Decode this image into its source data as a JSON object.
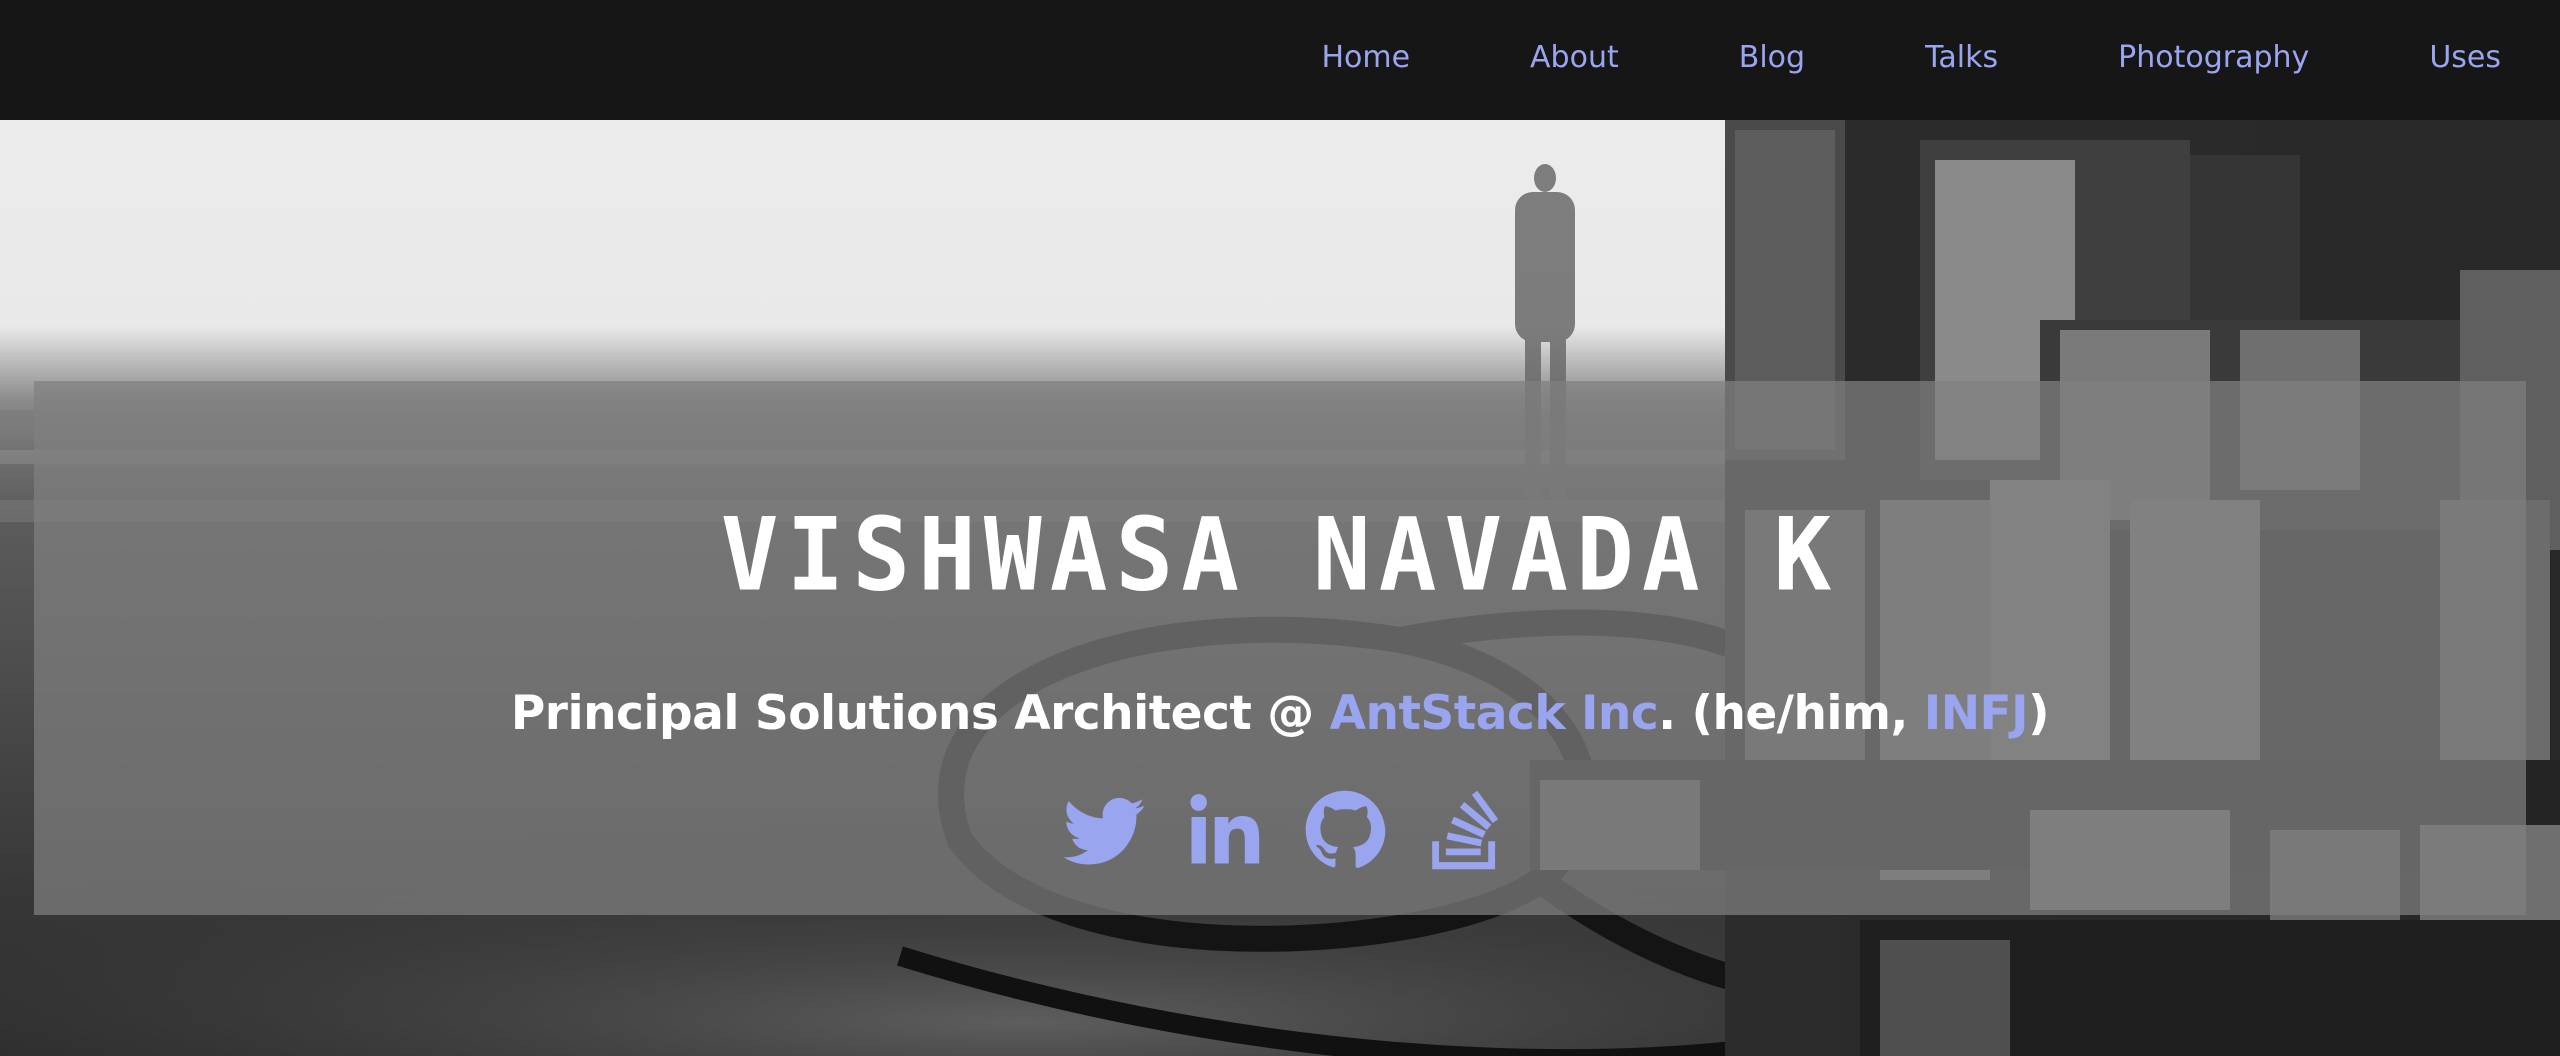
{
  "nav": {
    "items": [
      {
        "label": "Home"
      },
      {
        "label": "About"
      },
      {
        "label": "Blog"
      },
      {
        "label": "Talks"
      },
      {
        "label": "Photography"
      },
      {
        "label": "Uses"
      }
    ]
  },
  "hero": {
    "name": "VISHWASA NAVADA K",
    "subtitle": {
      "role": "Principal Solutions Architect @ ",
      "company": "AntStack Inc",
      "separator": ". (he/him, ",
      "personality": "INFJ",
      "closing": ")"
    },
    "social": [
      {
        "icon": "twitter-icon"
      },
      {
        "icon": "linkedin-icon"
      },
      {
        "icon": "github-icon"
      },
      {
        "icon": "stackoverflow-icon"
      }
    ]
  },
  "colors": {
    "nav_background": "#161616",
    "accent": "#9aa5f0",
    "overlay": "rgba(128,128,128,0.72)",
    "text": "#ffffff"
  }
}
